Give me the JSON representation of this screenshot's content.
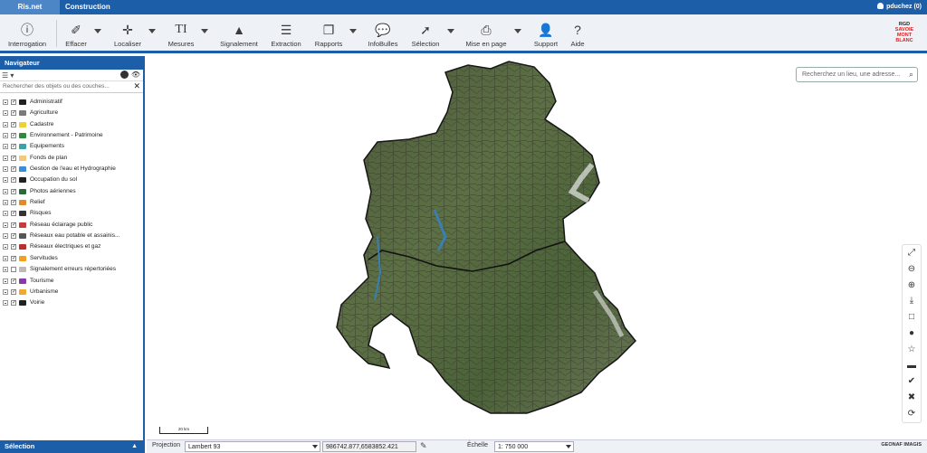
{
  "topbar": {
    "tabs": [
      "Ris.net Gestion",
      "Construction"
    ],
    "user": "pduchez (0)"
  },
  "toolbar": {
    "tools": [
      {
        "label": "Interrogation",
        "icon": "info-icon"
      },
      {
        "label": "Effacer",
        "icon": "eraser-icon"
      },
      {
        "label": "Localiser",
        "icon": "crosshair-icon"
      },
      {
        "label": "Mesures",
        "icon": "text-measure-icon"
      },
      {
        "label": "Signalement",
        "icon": "warning-icon"
      },
      {
        "label": "Extraction",
        "icon": "database-icon"
      },
      {
        "label": "Rapports",
        "icon": "copy-icon"
      },
      {
        "label": "InfoBulles",
        "icon": "chat-icon"
      },
      {
        "label": "Sélection",
        "icon": "cursor-icon"
      },
      {
        "label": "Mise en page",
        "icon": "printer-icon"
      },
      {
        "label": "Support",
        "icon": "user-icon"
      },
      {
        "label": "Aide",
        "icon": "help-icon"
      }
    ],
    "logo_lines": [
      "RGD",
      "SAVOIE",
      "MONT",
      "BLANC"
    ]
  },
  "navigator": {
    "title": "Navigateur",
    "search_placeholder": "Rechercher des objets ou des couches...",
    "layers": [
      {
        "label": "Administratif",
        "checked": true,
        "color": "#222222"
      },
      {
        "label": "Agriculture",
        "checked": true,
        "color": "#7a7a7a"
      },
      {
        "label": "Cadastre",
        "checked": true,
        "color": "#e8d33a"
      },
      {
        "label": "Environnement - Patrimoine",
        "checked": true,
        "color": "#2e8b3a"
      },
      {
        "label": "Equipements",
        "checked": true,
        "color": "#3aa3a3"
      },
      {
        "label": "Fonds de plan",
        "checked": true,
        "color": "#f2c97a"
      },
      {
        "label": "Gestion de l'eau et Hydrographie",
        "checked": true,
        "color": "#3a8ed8"
      },
      {
        "label": "Occupation du sol",
        "checked": true,
        "color": "#222222"
      },
      {
        "label": "Photos aériennes",
        "checked": true,
        "color": "#2a6a3a"
      },
      {
        "label": "Relief",
        "checked": true,
        "color": "#e08a2e"
      },
      {
        "label": "Risques",
        "checked": true,
        "color": "#333333"
      },
      {
        "label": "Réseau éclairage public",
        "checked": true,
        "color": "#c83a3a"
      },
      {
        "label": "Réseaux eau potable et assainis...",
        "checked": true,
        "color": "#555555"
      },
      {
        "label": "Réseaux électriques et gaz",
        "checked": true,
        "color": "#b83030"
      },
      {
        "label": "Servitudes",
        "checked": true,
        "color": "#f0a020"
      },
      {
        "label": "Signalement erreurs répertoriées",
        "checked": false,
        "color": "#bbbbbb"
      },
      {
        "label": "Tourisme",
        "checked": true,
        "color": "#8a3aa8"
      },
      {
        "label": "Urbanisme",
        "checked": true,
        "color": "#f0a830"
      },
      {
        "label": "Voirie",
        "checked": true,
        "color": "#222222"
      }
    ],
    "selection_label": "Sélection"
  },
  "map": {
    "search_placeholder": "Recherchez un lieu, une adresse...",
    "scale_label": "20 km",
    "tools": [
      "fullscreen-icon",
      "zoom-out-icon",
      "zoom-in-icon",
      "download-icon",
      "square-icon",
      "circle-icon",
      "star-icon",
      "minus-icon",
      "check-circle-icon",
      "close-icon",
      "refresh-icon"
    ]
  },
  "status": {
    "projection_label": "Projection",
    "projection_value": "Lambert 93",
    "coordinates": "986742.877,6583852.421",
    "scale_label": "Échelle",
    "scale_value": "1: 750 000",
    "credit": "GEONAF IMAGIS"
  }
}
